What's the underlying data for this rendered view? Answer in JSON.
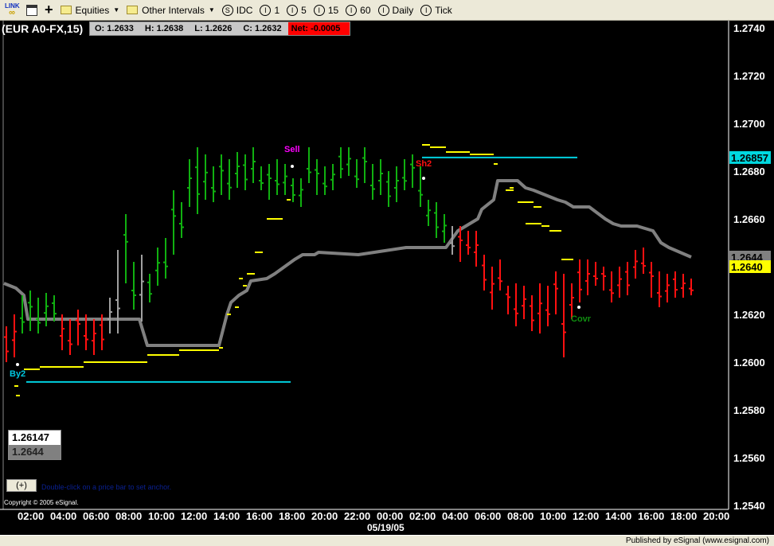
{
  "toolbar": {
    "link_label": "LINK",
    "equities": "Equities",
    "other_intervals": "Other Intervals",
    "symbol_source": "IDC",
    "intervals": [
      "1",
      "5",
      "15",
      "60",
      "Daily",
      "Tick"
    ]
  },
  "header": {
    "symbol": "(EUR A0-FX,15)",
    "open": "O: 1.2633",
    "high": "H: 1.2638",
    "low": "L: 1.2626",
    "close": "C: 1.2632",
    "net": "Net: -0.0005"
  },
  "infobox": {
    "line1": "1.26147",
    "line2": "1.2644"
  },
  "plus_button": "(+)",
  "hint": "Double-click on a price bar to set anchor.",
  "copyright": "Copyright © 2005 eSignal.",
  "date_label": "05/19/05",
  "status": "Published by eSignal (www.esignal.com)",
  "colors": {
    "up": "#10b010",
    "down": "#ff1010",
    "neutral": "#a0a0a0",
    "stop": "#808080",
    "signal": "#ffff00",
    "target": "#00d0e0"
  },
  "chart_data": {
    "type": "bar",
    "ylim": [
      1.254,
      1.274
    ],
    "yticks": [
      "1.2740",
      "1.2720",
      "1.2700",
      "1.2680",
      "1.2660",
      "1.2640",
      "1.2620",
      "1.2600",
      "1.2580",
      "1.2560",
      "1.2540"
    ],
    "xticks": [
      "02:00",
      "04:00",
      "06:00",
      "08:00",
      "10:00",
      "12:00",
      "14:00",
      "16:00",
      "18:00",
      "20:00",
      "22:00",
      "00:00",
      "02:00",
      "04:00",
      "06:00",
      "08:00",
      "10:00",
      "12:00",
      "14:00",
      "16:00",
      "18:00",
      "20:00"
    ],
    "price_markers": [
      {
        "label": "1.26857",
        "color": "#00d8e0",
        "price": 1.26857
      },
      {
        "label": "1.2644",
        "color": "#808080",
        "price": 1.2644
      },
      {
        "label": "1.2640",
        "color": "#ffff00",
        "price": 1.264
      }
    ],
    "bars": [
      [
        1.2615,
        1.26,
        "r"
      ],
      [
        1.262,
        1.2602,
        "r"
      ],
      [
        1.2628,
        1.2612,
        "g"
      ],
      [
        1.263,
        1.2613,
        "g"
      ],
      [
        1.2627,
        1.2612,
        "g"
      ],
      [
        1.2629,
        1.2615,
        "g"
      ],
      [
        1.2628,
        1.2617,
        "g"
      ],
      [
        1.262,
        1.2605,
        "r"
      ],
      [
        1.2618,
        1.2603,
        "r"
      ],
      [
        1.2622,
        1.2607,
        "r"
      ],
      [
        1.262,
        1.2605,
        "r"
      ],
      [
        1.2618,
        1.2603,
        "r"
      ],
      [
        1.262,
        1.2605,
        "r"
      ],
      [
        1.2627,
        1.2612,
        "n"
      ],
      [
        1.2647,
        1.2612,
        "n"
      ],
      [
        1.2662,
        1.2633,
        "g"
      ],
      [
        1.2642,
        1.2622,
        "g"
      ],
      [
        1.2645,
        1.2617,
        "n"
      ],
      [
        1.2637,
        1.2625,
        "g"
      ],
      [
        1.2648,
        1.2632,
        "g"
      ],
      [
        1.2652,
        1.2635,
        "g"
      ],
      [
        1.2672,
        1.2645,
        "g"
      ],
      [
        1.2667,
        1.2652,
        "g"
      ],
      [
        1.2685,
        1.2665,
        "g"
      ],
      [
        1.269,
        1.2662,
        "g"
      ],
      [
        1.2687,
        1.2668,
        "g"
      ],
      [
        1.2682,
        1.2667,
        "g"
      ],
      [
        1.2687,
        1.267,
        "g"
      ],
      [
        1.2685,
        1.2668,
        "g"
      ],
      [
        1.2688,
        1.2673,
        "g"
      ],
      [
        1.2687,
        1.2672,
        "g"
      ],
      [
        1.269,
        1.2675,
        "g"
      ],
      [
        1.2682,
        1.2672,
        "g"
      ],
      [
        1.2683,
        1.2668,
        "g"
      ],
      [
        1.2685,
        1.267,
        "g"
      ],
      [
        1.2683,
        1.267,
        "g"
      ],
      [
        1.2677,
        1.2667,
        "g"
      ],
      [
        1.2677,
        1.2665,
        "g"
      ],
      [
        1.269,
        1.2675,
        "g"
      ],
      [
        1.2685,
        1.267,
        "g"
      ],
      [
        1.2682,
        1.267,
        "g"
      ],
      [
        1.2683,
        1.2672,
        "g"
      ],
      [
        1.269,
        1.2677,
        "g"
      ],
      [
        1.269,
        1.2678,
        "g"
      ],
      [
        1.2685,
        1.2673,
        "g"
      ],
      [
        1.269,
        1.2675,
        "g"
      ],
      [
        1.2683,
        1.2668,
        "g"
      ],
      [
        1.2685,
        1.267,
        "g"
      ],
      [
        1.268,
        1.2665,
        "g"
      ],
      [
        1.2682,
        1.2667,
        "g"
      ],
      [
        1.2685,
        1.2672,
        "g"
      ],
      [
        1.2687,
        1.2673,
        "g"
      ],
      [
        1.2682,
        1.2665,
        "g"
      ],
      [
        1.2668,
        1.2657,
        "g"
      ],
      [
        1.2667,
        1.2652,
        "g"
      ],
      [
        1.2662,
        1.265,
        "g"
      ],
      [
        1.2657,
        1.2645,
        "n"
      ],
      [
        1.2657,
        1.2642,
        "r"
      ],
      [
        1.2655,
        1.2645,
        "r"
      ],
      [
        1.2655,
        1.264,
        "r"
      ],
      [
        1.2645,
        1.263,
        "r"
      ],
      [
        1.264,
        1.2622,
        "r"
      ],
      [
        1.2643,
        1.263,
        "r"
      ],
      [
        1.2632,
        1.262,
        "r"
      ],
      [
        1.2633,
        1.2615,
        "r"
      ],
      [
        1.2632,
        1.2618,
        "r"
      ],
      [
        1.2628,
        1.2613,
        "r"
      ],
      [
        1.2633,
        1.2612,
        "r"
      ],
      [
        1.2632,
        1.2615,
        "r"
      ],
      [
        1.2638,
        1.262,
        "r"
      ],
      [
        1.2637,
        1.2602,
        "r"
      ],
      [
        1.2633,
        1.2618,
        "r"
      ],
      [
        1.2643,
        1.2625,
        "r"
      ],
      [
        1.2643,
        1.2628,
        "r"
      ],
      [
        1.2642,
        1.2632,
        "r"
      ],
      [
        1.264,
        1.263,
        "r"
      ],
      [
        1.2638,
        1.2625,
        "r"
      ],
      [
        1.264,
        1.2627,
        "r"
      ],
      [
        1.2642,
        1.2628,
        "r"
      ],
      [
        1.2647,
        1.2635,
        "r"
      ],
      [
        1.2648,
        1.2637,
        "r"
      ],
      [
        1.2642,
        1.2627,
        "r"
      ],
      [
        1.2638,
        1.2623,
        "r"
      ],
      [
        1.2637,
        1.2625,
        "r"
      ],
      [
        1.2638,
        1.2627,
        "r"
      ],
      [
        1.2637,
        1.2627,
        "r"
      ],
      [
        1.2635,
        1.2628,
        "r"
      ]
    ],
    "stop_line": [
      [
        -0.3,
        1.2633
      ],
      [
        1.2,
        1.2631
      ],
      [
        2.2,
        1.2628
      ],
      [
        2.7,
        1.2618
      ],
      [
        16.7,
        1.2618
      ],
      [
        17.7,
        1.2607
      ],
      [
        26.7,
        1.2607
      ],
      [
        27.7,
        1.262
      ],
      [
        28.2,
        1.2625
      ],
      [
        29.2,
        1.2628
      ],
      [
        30.2,
        1.263
      ],
      [
        30.7,
        1.2634
      ],
      [
        32.7,
        1.2635
      ],
      [
        33.7,
        1.2637
      ],
      [
        36.2,
        1.2643
      ],
      [
        37.2,
        1.2645
      ],
      [
        38.7,
        1.2645
      ],
      [
        39.2,
        1.2646
      ],
      [
        44.2,
        1.2645
      ],
      [
        46.2,
        1.2646
      ],
      [
        50.2,
        1.2648
      ],
      [
        52.2,
        1.2648
      ],
      [
        55.2,
        1.2648
      ],
      [
        56.7,
        1.2655
      ],
      [
        59.2,
        1.266
      ],
      [
        59.7,
        1.2664
      ],
      [
        61.2,
        1.2668
      ],
      [
        61.7,
        1.2676
      ],
      [
        64.2,
        1.2676
      ],
      [
        65.2,
        1.2673
      ],
      [
        66.2,
        1.2672
      ],
      [
        67.7,
        1.267
      ],
      [
        69.2,
        1.2668
      ],
      [
        70.2,
        1.2667
      ],
      [
        71.2,
        1.2665
      ],
      [
        73.2,
        1.2665
      ],
      [
        75.2,
        1.266
      ],
      [
        76.2,
        1.2658
      ],
      [
        77.2,
        1.2657
      ],
      [
        79.2,
        1.2657
      ],
      [
        81.2,
        1.2655
      ],
      [
        82.2,
        1.265
      ],
      [
        83.2,
        1.2648
      ],
      [
        86.0,
        1.2644
      ]
    ],
    "signal_levels": [
      [
        2.2,
        4.2,
        1.2597
      ],
      [
        4.2,
        9.7,
        1.2598
      ],
      [
        9.7,
        17.7,
        1.26
      ],
      [
        17.7,
        21.7,
        1.2603
      ],
      [
        21.7,
        26.7,
        1.2605
      ],
      [
        26.7,
        27.2,
        1.2606
      ],
      [
        27.7,
        28.2,
        1.262
      ],
      [
        28.7,
        29.2,
        1.2623
      ],
      [
        29.7,
        30.2,
        1.2632
      ],
      [
        29.2,
        29.7,
        1.2635
      ],
      [
        30.2,
        31.2,
        1.2637
      ],
      [
        31.2,
        32.2,
        1.2646
      ],
      [
        32.7,
        34.7,
        1.266
      ],
      [
        35.2,
        35.7,
        1.2668
      ],
      [
        52.2,
        53.2,
        1.2691
      ],
      [
        53.2,
        55.2,
        1.269
      ],
      [
        55.2,
        58.2,
        1.2688
      ],
      [
        58.2,
        61.2,
        1.2687
      ],
      [
        61.2,
        61.7,
        1.2683
      ],
      [
        63.2,
        63.7,
        1.2673
      ],
      [
        62.7,
        63.7,
        1.2672
      ],
      [
        64.2,
        65.2,
        1.2667
      ],
      [
        65.2,
        66.2,
        1.2667
      ],
      [
        66.2,
        67.2,
        1.2665
      ],
      [
        65.2,
        67.2,
        1.2658
      ],
      [
        67.2,
        68.2,
        1.2657
      ],
      [
        68.2,
        69.7,
        1.2655
      ],
      [
        69.7,
        71.2,
        1.2643
      ],
      [
        1.0,
        1.5,
        1.259
      ],
      [
        1.2,
        1.7,
        1.2586
      ]
    ],
    "target_lines": [
      [
        2.5,
        35.7,
        1.25917
      ],
      [
        52.2,
        71.7,
        1.26857
      ]
    ],
    "signals": [
      {
        "label": "By2",
        "bar": 1.4,
        "price": 1.2599,
        "color": "#00c8e0",
        "label_price": 1.2594
      },
      {
        "label": "Sell",
        "bar": 35.9,
        "price": 1.2682,
        "color": "#ff00ff",
        "label_price": 1.2688
      },
      {
        "label": "Sh2",
        "bar": 52.4,
        "price": 1.2677,
        "color": "#ff1010",
        "label_price": 1.2682
      },
      {
        "label": "Covr",
        "bar": 71.9,
        "price": 1.2623,
        "color": "#109010",
        "label_price": 1.2617
      }
    ]
  }
}
